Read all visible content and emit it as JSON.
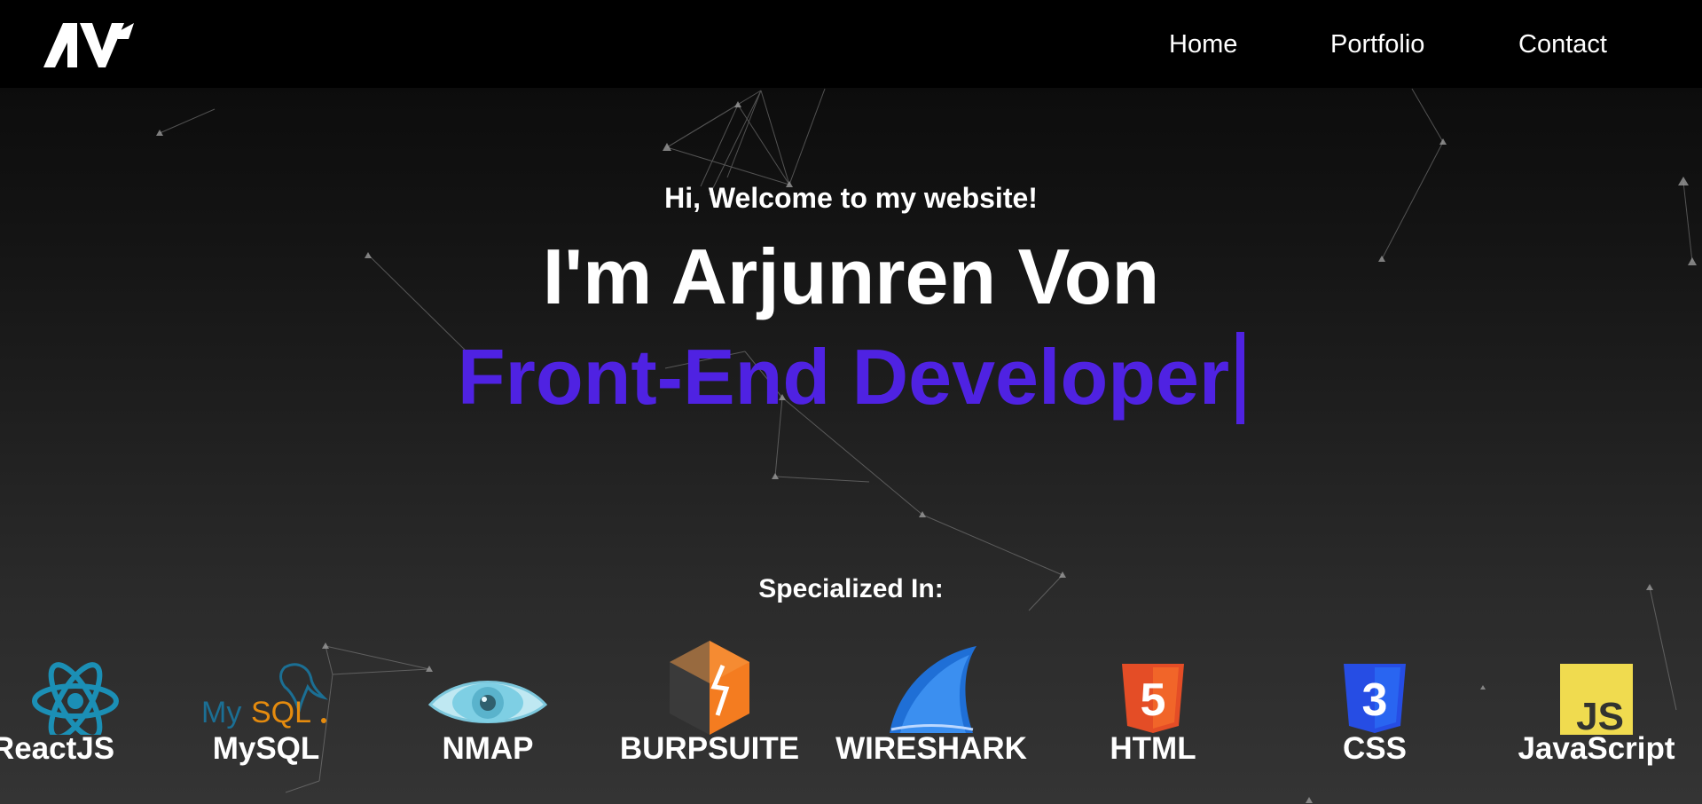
{
  "nav": {
    "logo_text": "AV",
    "links": [
      "Home",
      "Portfolio",
      "Contact"
    ]
  },
  "hero": {
    "welcome": "Hi, Welcome to my website!",
    "name": "I'm Arjunren Von",
    "role": "Front-End Developer",
    "specialized_heading": "Specialized In:"
  },
  "skills": [
    {
      "label": "ReactJS",
      "icon": "react-icon"
    },
    {
      "label": "MySQL",
      "icon": "mysql-icon"
    },
    {
      "label": "NMAP",
      "icon": "nmap-eye-icon"
    },
    {
      "label": "BURPSUITE",
      "icon": "burpsuite-icon"
    },
    {
      "label": "WIRESHARK",
      "icon": "wireshark-fin-icon"
    },
    {
      "label": "HTML",
      "icon": "html5-icon"
    },
    {
      "label": "CSS",
      "icon": "css3-icon"
    },
    {
      "label": "JavaScript",
      "icon": "javascript-icon"
    }
  ],
  "colors": {
    "accent": "#4f22e2",
    "background_top": "#080808",
    "background_bottom": "#343434",
    "text": "#ffffff"
  }
}
